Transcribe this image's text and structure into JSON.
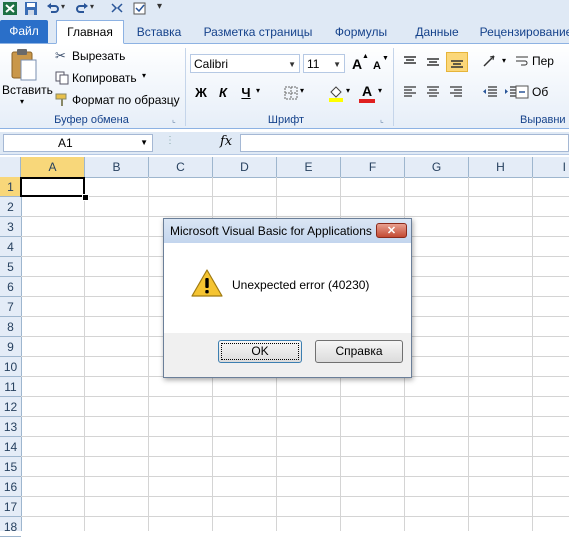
{
  "quick_access": {
    "icons": [
      "excel-icon",
      "save-icon",
      "undo-icon",
      "redo-icon",
      "macro-icon",
      "customize-icon"
    ]
  },
  "tabs": [
    {
      "label": "Файл"
    },
    {
      "label": "Главная"
    },
    {
      "label": "Вставка"
    },
    {
      "label": "Разметка страницы"
    },
    {
      "label": "Формулы"
    },
    {
      "label": "Данные"
    },
    {
      "label": "Рецензирование"
    }
  ],
  "ribbon": {
    "clipboard": {
      "paste": "Вставить",
      "cut": "Вырезать",
      "copy": "Копировать",
      "format_painter": "Формат по образцу",
      "group_label": "Буфер обмена"
    },
    "font": {
      "font_name": "Calibri",
      "font_size": "11",
      "bold": "Ж",
      "italic": "К",
      "underline": "Ч",
      "grow": "A",
      "shrink": "A",
      "font_color_letter": "A",
      "group_label": "Шрифт",
      "font_color": "#e02020",
      "fill_color": "#ffff00"
    },
    "alignment": {
      "wrap_label": "Пер",
      "merge_label": "Об",
      "group_label": "Выравни"
    }
  },
  "formula_bar": {
    "name_box": "A1",
    "fx": "fx",
    "formula": ""
  },
  "grid": {
    "columns": [
      "A",
      "B",
      "C",
      "D",
      "E",
      "F",
      "G",
      "H",
      "I"
    ],
    "rows": [
      "1",
      "2",
      "3",
      "4",
      "5",
      "6",
      "7",
      "8",
      "9",
      "10",
      "11",
      "12",
      "13",
      "14",
      "15",
      "16",
      "17",
      "18"
    ],
    "selected_cell": "A1"
  },
  "dialog": {
    "title": "Microsoft Visual Basic for Applications",
    "close": "✕",
    "message": "Unexpected error (40230)",
    "ok": "OK",
    "help": "Справка"
  }
}
